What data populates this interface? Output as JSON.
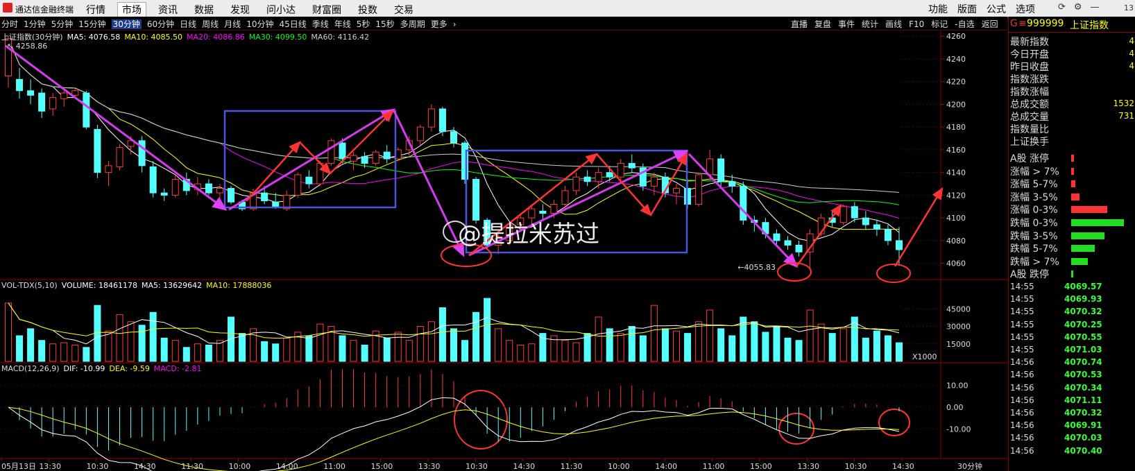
{
  "app": {
    "title": "通达信金融终端"
  },
  "top_menu": [
    "行情",
    "市场",
    "资讯",
    "数据",
    "发现",
    "问小达",
    "财富圈",
    "投数",
    "交易"
  ],
  "top_menu_active": 1,
  "top_right_menu": [
    "功能",
    "版面",
    "公式",
    "选项"
  ],
  "top_right_icons": [
    "refresh-icon",
    "settings-icon",
    "minimize-icon"
  ],
  "top_right_icon_glyphs": [
    "⟳",
    "⚙",
    "—"
  ],
  "clock": "13",
  "periods": [
    "分时",
    "1分钟",
    "5分钟",
    "15分钟",
    "30分钟",
    "60分钟",
    "日线",
    "周线",
    "月线",
    "10分钟",
    "45日线",
    "季线",
    "年线",
    "5秒",
    "15秒",
    "多周期",
    "更多"
  ],
  "period_active": 4,
  "toolbar": [
    "直播",
    "复盘",
    "事件",
    "统计",
    "画线",
    "F10",
    "标记",
    "-自选",
    "返回"
  ],
  "main_legend": {
    "title": "上证指数(30分钟)",
    "items": [
      {
        "label": "MA5: 4076.58",
        "color": "#ffffff"
      },
      {
        "label": "MA10: 4085.50",
        "color": "#ffff00"
      },
      {
        "label": "MA20: 4086.86",
        "color": "#ff00ff"
      },
      {
        "label": "MA30: 4099.50",
        "color": "#00ff00"
      },
      {
        "label": "MA60: 4116.42",
        "color": "#cccccc"
      }
    ]
  },
  "high_label": "4258.86",
  "low_label": "4055.83",
  "price_axis": [
    "4260",
    "4240",
    "4220",
    "4200",
    "4180",
    "4160",
    "4140",
    "4120",
    "4100",
    "4080",
    "4060"
  ],
  "vol_legend": {
    "title": "VOL-TDX(5,10)",
    "items": [
      {
        "label": "VOLUME: 18461178",
        "color": "#ffffff"
      },
      {
        "label": "MA5: 13629642",
        "color": "#ffffff"
      },
      {
        "label": "MA10: 17888036",
        "color": "#ffff00"
      }
    ]
  },
  "vol_axis": [
    "45000",
    "30000",
    "15000"
  ],
  "vol_unit": "X1000",
  "macd_legend": {
    "title": "MACD(12,26,9)",
    "items": [
      {
        "label": "DIF: -10.99",
        "color": "#ffffff"
      },
      {
        "label": "DEA: -9.59",
        "color": "#ffff00"
      },
      {
        "label": "MACD: -2.81",
        "color": "#ff00ff"
      }
    ]
  },
  "macd_axis": [
    "10.00",
    "0.00",
    "-10.00"
  ],
  "time_axis": [
    "05月13日",
    "13:30",
    "10:30",
    "14:30",
    "11:30",
    "10:00",
    "14:00",
    "11:00",
    "15:00",
    "13:30",
    "10:30",
    "14:30",
    "11:30",
    "10:00",
    "14:00",
    "11:00",
    "15:00",
    "13:30",
    "10:30",
    "14:30"
  ],
  "period_label": "30分钟",
  "watermark": "@提拉米苏过",
  "right_panel": {
    "g": "G",
    "code": "999999",
    "name": "上证指数",
    "stats": [
      {
        "label": "最新指数",
        "value": "4"
      },
      {
        "label": "今日开盘",
        "value": "4"
      },
      {
        "label": "昨日收盘",
        "value": "4"
      },
      {
        "label": "指数涨跌",
        "value": ""
      },
      {
        "label": "指数涨幅",
        "value": ""
      },
      {
        "label": "总成交额",
        "value": "1532"
      },
      {
        "label": "总成交量",
        "value": "731"
      },
      {
        "label": "指数量比",
        "value": ""
      },
      {
        "label": "上证换手",
        "value": ""
      }
    ],
    "distribution": [
      {
        "label": "A股 涨停",
        "color": "#ff3333",
        "level": 0.05
      },
      {
        "label": "涨幅 > 7%",
        "color": "#ff3333",
        "level": 0.05
      },
      {
        "label": "涨幅 5-7%",
        "color": "#ff3333",
        "level": 0.07
      },
      {
        "label": "涨幅 3-5%",
        "color": "#ff3333",
        "level": 0.15
      },
      {
        "label": "涨幅 0-3%",
        "color": "#ff3333",
        "level": 0.65
      },
      {
        "label": "跌幅 0-3%",
        "color": "#22dd22",
        "level": 0.95
      },
      {
        "label": "跌幅 3-5%",
        "color": "#22dd22",
        "level": 0.6
      },
      {
        "label": "跌幅 5-7%",
        "color": "#22dd22",
        "level": 0.42
      },
      {
        "label": "跌幅 > 7%",
        "color": "#22dd22",
        "level": 0.3
      },
      {
        "label": "A股 跌停",
        "color": "#22dd22",
        "level": 0.04
      }
    ],
    "ticks": [
      {
        "time": "14:55",
        "price": "4069.57"
      },
      {
        "time": "14:55",
        "price": "4069.93"
      },
      {
        "time": "14:55",
        "price": "4070.32"
      },
      {
        "time": "14:55",
        "price": "4070.25"
      },
      {
        "time": "14:55",
        "price": "4070.55"
      },
      {
        "time": "14:55",
        "price": "4071.03"
      },
      {
        "time": "14:56",
        "price": "4070.74"
      },
      {
        "time": "14:56",
        "price": "4070.53"
      },
      {
        "time": "14:56",
        "price": "4070.34"
      },
      {
        "time": "14:56",
        "price": "4071.11"
      },
      {
        "time": "14:56",
        "price": "4070.32"
      },
      {
        "time": "14:56",
        "price": "4069.91"
      },
      {
        "time": "14:56",
        "price": "4070.03"
      },
      {
        "time": "14:56",
        "price": "4070.40"
      }
    ]
  },
  "chart_data": {
    "type": "candlestick",
    "ylim": [
      4050,
      4265
    ],
    "candles": [
      [
        4225,
        4260,
        4215,
        4258
      ],
      [
        4222,
        4232,
        4205,
        4212
      ],
      [
        4212,
        4222,
        4200,
        4208
      ],
      [
        4210,
        4214,
        4188,
        4194
      ],
      [
        4196,
        4210,
        4190,
        4206
      ],
      [
        4205,
        4212,
        4198,
        4210
      ],
      [
        4208,
        4214,
        4205,
        4212
      ],
      [
        4210,
        4212,
        4178,
        4180
      ],
      [
        4178,
        4182,
        4135,
        4140
      ],
      [
        4140,
        4150,
        4128,
        4146
      ],
      [
        4145,
        4165,
        4142,
        4162
      ],
      [
        4163,
        4172,
        4156,
        4168
      ],
      [
        4168,
        4172,
        4140,
        4146
      ],
      [
        4145,
        4150,
        4118,
        4122
      ],
      [
        4122,
        4126,
        4115,
        4120
      ],
      [
        4120,
        4138,
        4118,
        4134
      ],
      [
        4134,
        4140,
        4120,
        4124
      ],
      [
        4125,
        4136,
        4120,
        4130
      ],
      [
        4130,
        4134,
        4120,
        4122
      ],
      [
        4122,
        4130,
        4116,
        4126
      ],
      [
        4126,
        4128,
        4112,
        4114
      ],
      [
        4114,
        4116,
        4106,
        4108
      ],
      [
        4108,
        4126,
        4106,
        4122
      ],
      [
        4122,
        4128,
        4112,
        4115
      ],
      [
        4114,
        4122,
        4108,
        4110
      ],
      [
        4108,
        4124,
        4106,
        4120
      ],
      [
        4120,
        4140,
        4118,
        4138
      ],
      [
        4136,
        4142,
        4126,
        4130
      ],
      [
        4130,
        4150,
        4128,
        4148
      ],
      [
        4148,
        4170,
        4146,
        4168
      ],
      [
        4166,
        4170,
        4148,
        4152
      ],
      [
        4150,
        4158,
        4142,
        4155
      ],
      [
        4154,
        4158,
        4144,
        4148
      ],
      [
        4148,
        4160,
        4146,
        4158
      ],
      [
        4158,
        4164,
        4148,
        4152
      ],
      [
        4152,
        4162,
        4150,
        4160
      ],
      [
        4160,
        4172,
        4155,
        4168
      ],
      [
        4168,
        4182,
        4164,
        4180
      ],
      [
        4180,
        4200,
        4176,
        4196
      ],
      [
        4196,
        4198,
        4172,
        4176
      ],
      [
        4176,
        4180,
        4162,
        4166
      ],
      [
        4166,
        4168,
        4130,
        4134
      ],
      [
        4134,
        4136,
        4095,
        4098
      ],
      [
        4098,
        4100,
        4072,
        4076
      ],
      [
        4076,
        4088,
        4068,
        4082
      ],
      [
        4080,
        4096,
        4076,
        4094
      ],
      [
        4094,
        4104,
        4088,
        4100
      ],
      [
        4100,
        4112,
        4094,
        4108
      ],
      [
        4106,
        4112,
        4098,
        4104
      ],
      [
        4104,
        4116,
        4100,
        4112
      ],
      [
        4112,
        4128,
        4108,
        4124
      ],
      [
        4124,
        4140,
        4120,
        4136
      ],
      [
        4136,
        4142,
        4128,
        4132
      ],
      [
        4132,
        4144,
        4126,
        4140
      ],
      [
        4140,
        4146,
        4132,
        4136
      ],
      [
        4136,
        4152,
        4130,
        4148
      ],
      [
        4148,
        4156,
        4140,
        4144
      ],
      [
        4144,
        4148,
        4124,
        4128
      ],
      [
        4128,
        4140,
        4120,
        4136
      ],
      [
        4136,
        4140,
        4118,
        4122
      ],
      [
        4122,
        4130,
        4112,
        4126
      ],
      [
        4126,
        4134,
        4108,
        4112
      ],
      [
        4112,
        4140,
        4110,
        4138
      ],
      [
        4138,
        4160,
        4134,
        4152
      ],
      [
        4152,
        4156,
        4128,
        4132
      ],
      [
        4132,
        4138,
        4122,
        4128
      ],
      [
        4128,
        4132,
        4094,
        4098
      ],
      [
        4098,
        4102,
        4088,
        4096
      ],
      [
        4096,
        4100,
        4082,
        4086
      ],
      [
        4086,
        4090,
        4076,
        4080
      ],
      [
        4080,
        4084,
        4072,
        4076
      ],
      [
        4076,
        4080,
        4066,
        4070
      ],
      [
        4070,
        4090,
        4056,
        4086
      ],
      [
        4086,
        4104,
        4084,
        4100
      ],
      [
        4100,
        4106,
        4092,
        4096
      ],
      [
        4096,
        4112,
        4094,
        4110
      ],
      [
        4110,
        4114,
        4096,
        4100
      ],
      [
        4100,
        4106,
        4090,
        4094
      ],
      [
        4094,
        4098,
        4084,
        4090
      ],
      [
        4090,
        4094,
        4076,
        4080
      ],
      [
        4080,
        4092,
        4058,
        4072
      ]
    ],
    "volumes": [
      50,
      22,
      28,
      18,
      15,
      16,
      14,
      12,
      48,
      26,
      40,
      34,
      31,
      42,
      20,
      18,
      12,
      15,
      14,
      18,
      38,
      24,
      28,
      17,
      15,
      20,
      25,
      22,
      32,
      30,
      22,
      18,
      14,
      26,
      20,
      25,
      18,
      30,
      34,
      46,
      28,
      18,
      42,
      54,
      28,
      18,
      14,
      15,
      24,
      22,
      18,
      16,
      24,
      38,
      28,
      24,
      30,
      22,
      48,
      28,
      26,
      24,
      34,
      44,
      28,
      22,
      38,
      34,
      25,
      30,
      20,
      18,
      44,
      32,
      24,
      28,
      38,
      20,
      26,
      22,
      16
    ]
  }
}
